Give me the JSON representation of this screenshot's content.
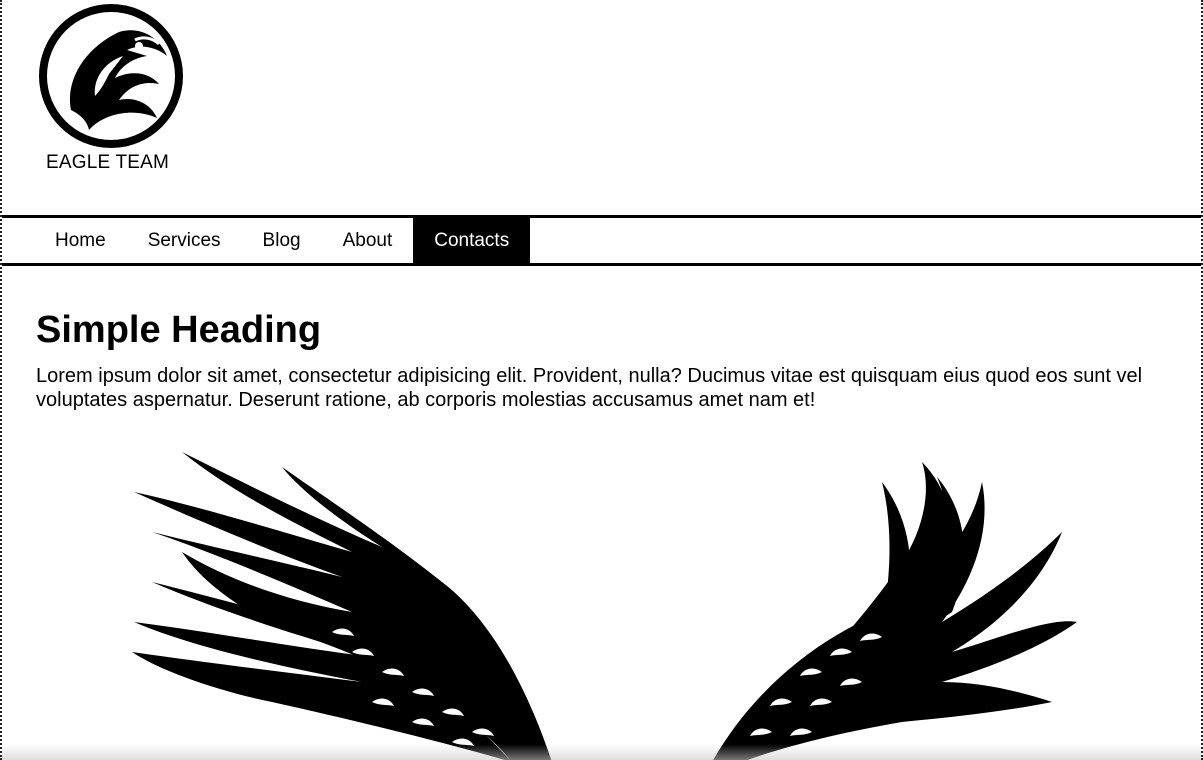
{
  "brand": {
    "name": "EAGLE TEAM",
    "logo_icon": "eagle-head-icon"
  },
  "nav": {
    "items": [
      {
        "label": "Home",
        "active": false
      },
      {
        "label": "Services",
        "active": false
      },
      {
        "label": "Blog",
        "active": false
      },
      {
        "label": "About",
        "active": false
      },
      {
        "label": "Contacts",
        "active": true
      }
    ]
  },
  "main": {
    "heading": "Simple Heading",
    "paragraph": "Lorem ipsum dolor sit amet, consectetur adipisicing elit. Provident, nulla? Ducimus vitae est quisquam eius quod eos sunt vel voluptates aspernatur. Deserunt ratione, ab corporis molestias accusamus amet nam et!",
    "image_icon": "eagle-wings-icon"
  },
  "colors": {
    "text": "#000000",
    "background": "#ffffff",
    "active_tab_bg": "#000000",
    "active_tab_text": "#ffffff"
  }
}
